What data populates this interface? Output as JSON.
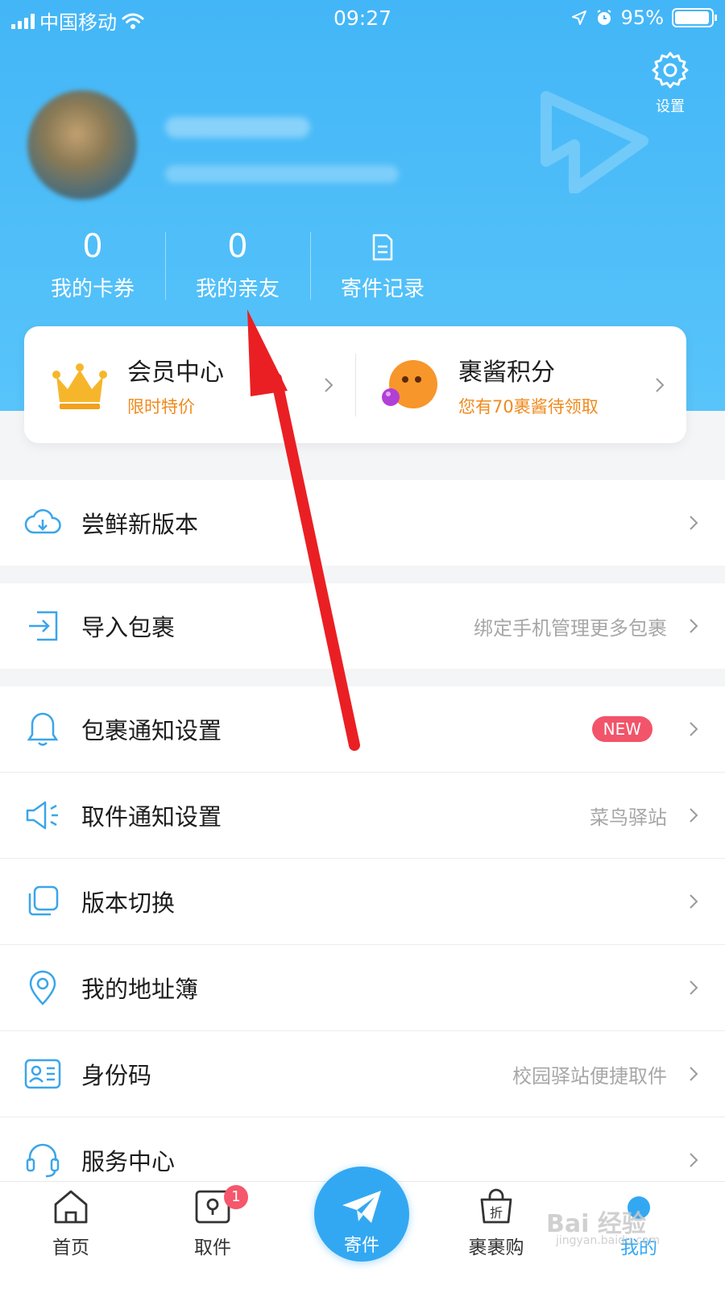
{
  "status_bar": {
    "carrier": "中国移动",
    "time": "09:27",
    "battery": "95%"
  },
  "header": {
    "settings_label": "设置",
    "stats": [
      {
        "value": "0",
        "label": "我的卡券"
      },
      {
        "value": "0",
        "label": "我的亲友"
      },
      {
        "value": "",
        "label": "寄件记录"
      }
    ]
  },
  "cards": [
    {
      "title": "会员中心",
      "subtitle": "限时特价"
    },
    {
      "title": "裹酱积分",
      "subtitle": "您有70裹酱待领取"
    }
  ],
  "menu": [
    {
      "label": "尝鲜新版本",
      "right": "",
      "icon": "cloud-download-icon"
    },
    {
      "label": "导入包裹",
      "right": "绑定手机管理更多包裹",
      "icon": "import-icon"
    },
    {
      "label": "包裹通知设置",
      "right": "",
      "badge": "NEW",
      "icon": "bell-icon"
    },
    {
      "label": "取件通知设置",
      "right": "菜鸟驿站",
      "icon": "megaphone-icon"
    },
    {
      "label": "版本切换",
      "right": "",
      "icon": "switch-icon"
    },
    {
      "label": "我的地址簿",
      "right": "",
      "icon": "location-icon"
    },
    {
      "label": "身份码",
      "right": "校园驿站便捷取件",
      "icon": "id-card-icon"
    },
    {
      "label": "服务中心",
      "right": "",
      "icon": "headset-icon"
    }
  ],
  "tabbar": {
    "tabs": [
      {
        "label": "首页"
      },
      {
        "label": "取件",
        "badge": "1"
      },
      {
        "label": "寄件"
      },
      {
        "label": "裹裹购",
        "icon_text": "折"
      },
      {
        "label": "我的"
      }
    ]
  },
  "watermark": {
    "text": "Bai 经验",
    "sub": "jingyan.baidu.com"
  },
  "colors": {
    "header": "#43b6f7",
    "accent": "#33a8f2",
    "orange": "#f08a1d",
    "badge": "#f2546a"
  }
}
